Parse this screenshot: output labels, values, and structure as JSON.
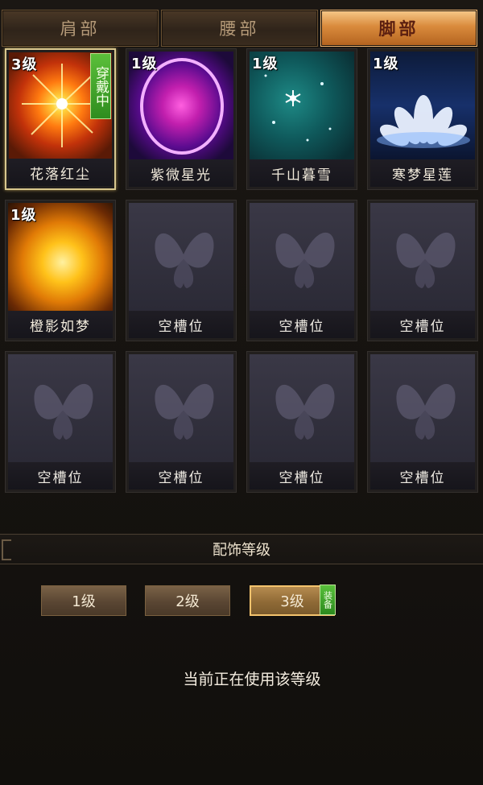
{
  "tabs": [
    {
      "label": "肩部",
      "active": false
    },
    {
      "label": "腰部",
      "active": false
    },
    {
      "label": "脚部",
      "active": true
    }
  ],
  "slots": [
    {
      "level": "3级",
      "name": "花落红尘",
      "art": "fire-burst-icon",
      "wearing": "穿戴中"
    },
    {
      "level": "1级",
      "name": "紫微星光",
      "art": "purple-ring-icon"
    },
    {
      "level": "1级",
      "name": "千山暮雪",
      "art": "snowflake-icon"
    },
    {
      "level": "1级",
      "name": "寒梦星莲",
      "art": "lotus-icon"
    },
    {
      "level": "1级",
      "name": "橙影如梦",
      "art": "sun-icon"
    },
    {
      "name": "空槽位"
    },
    {
      "name": "空槽位"
    },
    {
      "name": "空槽位"
    },
    {
      "name": "空槽位"
    },
    {
      "name": "空槽位"
    },
    {
      "name": "空槽位"
    },
    {
      "name": "空槽位"
    }
  ],
  "section": {
    "title": "配饰等级"
  },
  "level_buttons": [
    {
      "label": "1级",
      "active": false
    },
    {
      "label": "2级",
      "active": false
    },
    {
      "label": "3级",
      "active": true,
      "tag": "装备"
    }
  ],
  "status": "当前正在使用该等级",
  "colors": {
    "background": "#15120f",
    "active_tab": "#d98a3c",
    "wear_badge": "#2f8d1f",
    "selected_border": "#d8c78e"
  }
}
